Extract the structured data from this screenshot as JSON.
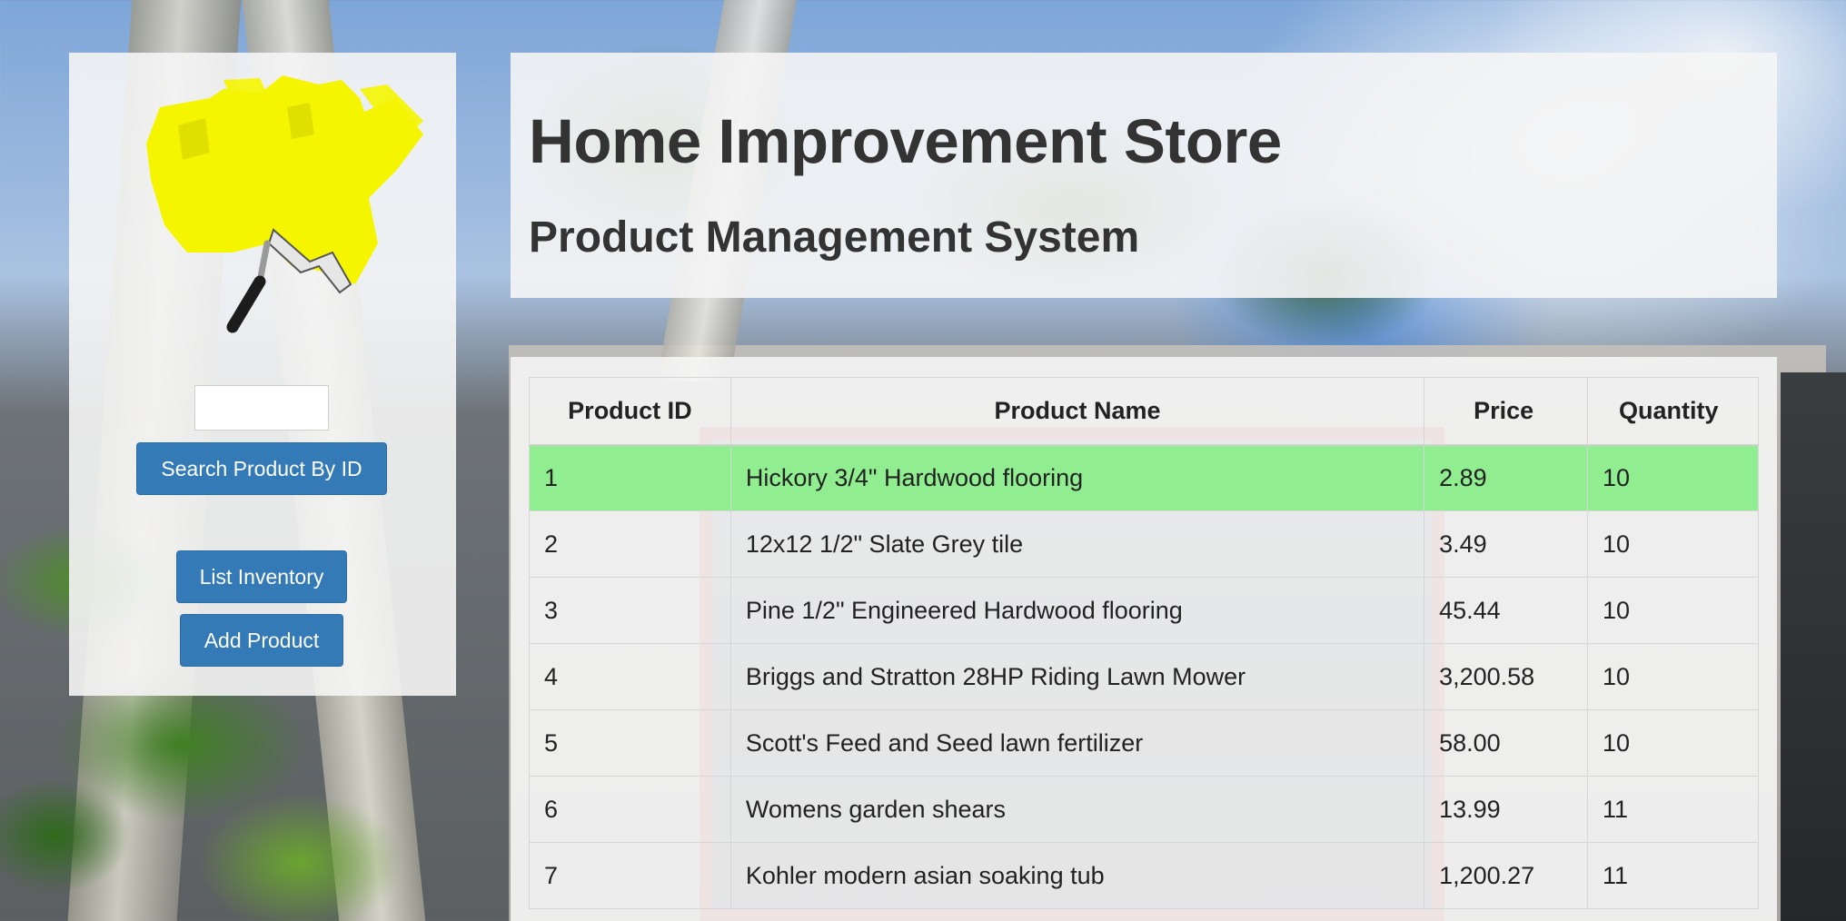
{
  "header": {
    "title": "Home Improvement Store",
    "subtitle": "Product Management System"
  },
  "sidebar": {
    "logo_icon": "paint-roller-icon",
    "search_input_value": "",
    "search_button_label": "Search Product By ID",
    "list_inventory_label": "List Inventory",
    "add_product_label": "Add Product"
  },
  "table": {
    "columns": [
      "Product ID",
      "Product Name",
      "Price",
      "Quantity"
    ],
    "rows": [
      {
        "id": "1",
        "name": "Hickory 3/4\" Hardwood flooring",
        "price": "2.89",
        "quantity": "10",
        "selected": true
      },
      {
        "id": "2",
        "name": "12x12 1/2\" Slate Grey tile",
        "price": "3.49",
        "quantity": "10",
        "selected": false
      },
      {
        "id": "3",
        "name": "Pine 1/2\" Engineered Hardwood flooring",
        "price": "45.44",
        "quantity": "10",
        "selected": false
      },
      {
        "id": "4",
        "name": "Briggs and Stratton 28HP Riding Lawn Mower",
        "price": "3,200.58",
        "quantity": "10",
        "selected": false
      },
      {
        "id": "5",
        "name": "Scott's Feed and Seed lawn fertilizer",
        "price": "58.00",
        "quantity": "10",
        "selected": false
      },
      {
        "id": "6",
        "name": "Womens garden shears",
        "price": "13.99",
        "quantity": "11",
        "selected": false
      },
      {
        "id": "7",
        "name": "Kohler modern asian soaking tub",
        "price": "1,200.27",
        "quantity": "11",
        "selected": false
      }
    ],
    "selected_row_color": "#90ee90"
  },
  "colors": {
    "button_primary": "#337ab7",
    "logo_yellow": "#f5f500"
  }
}
